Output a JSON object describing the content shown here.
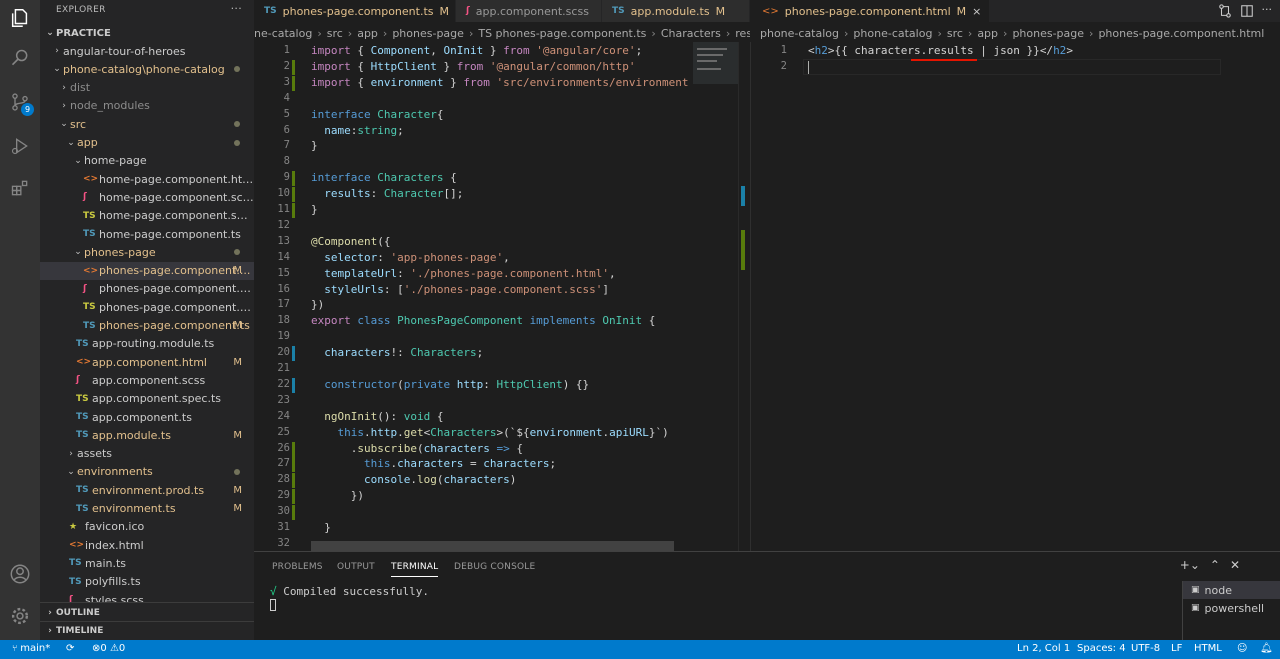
{
  "activity": {
    "source_control_badge": "9"
  },
  "sidebar": {
    "explorer_title": "EXPLORER",
    "section": "PRACTICE",
    "items": [
      {
        "label": "angular-tour-of-heroes",
        "indent": 1,
        "twisty": "›",
        "icon": "",
        "color": "#cccccc"
      },
      {
        "label": "phone-catalog\\phone-catalog",
        "indent": 1,
        "twisty": "⌄",
        "icon": "",
        "color": "#e2c08d",
        "dot": true
      },
      {
        "label": "dist",
        "indent": 2,
        "twisty": "›",
        "icon": "",
        "color": "#8c8c8c"
      },
      {
        "label": "node_modules",
        "indent": 2,
        "twisty": "›",
        "icon": "",
        "color": "#8c8c8c"
      },
      {
        "label": "src",
        "indent": 2,
        "twisty": "⌄",
        "icon": "",
        "color": "#e2c08d",
        "dot": true
      },
      {
        "label": "app",
        "indent": 3,
        "twisty": "⌄",
        "icon": "",
        "color": "#e2c08d",
        "dot": true
      },
      {
        "label": "home-page",
        "indent": 4,
        "twisty": "⌄",
        "icon": "",
        "color": "#cccccc"
      },
      {
        "label": "home-page.component.html",
        "indent": 5,
        "icon": "<>",
        "icolor": "#e37933",
        "color": "#cccccc"
      },
      {
        "label": "home-page.component.scss",
        "indent": 5,
        "icon": "ʃ",
        "icolor": "#f55385",
        "color": "#cccccc"
      },
      {
        "label": "home-page.component.spec.ts",
        "indent": 5,
        "icon": "TS",
        "icolor": "#cbcb41",
        "color": "#cccccc"
      },
      {
        "label": "home-page.component.ts",
        "indent": 5,
        "icon": "TS",
        "icolor": "#519aba",
        "color": "#cccccc"
      },
      {
        "label": "phones-page",
        "indent": 4,
        "twisty": "⌄",
        "icon": "",
        "color": "#e2c08d",
        "dot": true
      },
      {
        "label": "phones-page.component....",
        "indent": 5,
        "icon": "<>",
        "icolor": "#e37933",
        "color": "#e2c08d",
        "status": "M",
        "selected": true
      },
      {
        "label": "phones-page.component.scss",
        "indent": 5,
        "icon": "ʃ",
        "icolor": "#f55385",
        "color": "#cccccc"
      },
      {
        "label": "phones-page.component.spec.ts",
        "indent": 5,
        "icon": "TS",
        "icolor": "#cbcb41",
        "color": "#cccccc"
      },
      {
        "label": "phones-page.component.ts",
        "indent": 5,
        "icon": "TS",
        "icolor": "#519aba",
        "color": "#e2c08d",
        "status": "M"
      },
      {
        "label": "app-routing.module.ts",
        "indent": 4,
        "icon": "TS",
        "icolor": "#519aba",
        "color": "#cccccc"
      },
      {
        "label": "app.component.html",
        "indent": 4,
        "icon": "<>",
        "icolor": "#e37933",
        "color": "#e2c08d",
        "status": "M"
      },
      {
        "label": "app.component.scss",
        "indent": 4,
        "icon": "ʃ",
        "icolor": "#f55385",
        "color": "#cccccc"
      },
      {
        "label": "app.component.spec.ts",
        "indent": 4,
        "icon": "TS",
        "icolor": "#cbcb41",
        "color": "#cccccc"
      },
      {
        "label": "app.component.ts",
        "indent": 4,
        "icon": "TS",
        "icolor": "#519aba",
        "color": "#cccccc"
      },
      {
        "label": "app.module.ts",
        "indent": 4,
        "icon": "TS",
        "icolor": "#519aba",
        "color": "#e2c08d",
        "status": "M"
      },
      {
        "label": "assets",
        "indent": 3,
        "twisty": "›",
        "icon": "",
        "color": "#cccccc"
      },
      {
        "label": "environments",
        "indent": 3,
        "twisty": "⌄",
        "icon": "",
        "color": "#e2c08d",
        "dot": true
      },
      {
        "label": "environment.prod.ts",
        "indent": 4,
        "icon": "TS",
        "icolor": "#519aba",
        "color": "#e2c08d",
        "status": "M"
      },
      {
        "label": "environment.ts",
        "indent": 4,
        "icon": "TS",
        "icolor": "#519aba",
        "color": "#e2c08d",
        "status": "M"
      },
      {
        "label": "favicon.ico",
        "indent": 3,
        "icon": "★",
        "icolor": "#cbcb41",
        "color": "#cccccc"
      },
      {
        "label": "index.html",
        "indent": 3,
        "icon": "<>",
        "icolor": "#e37933",
        "color": "#cccccc"
      },
      {
        "label": "main.ts",
        "indent": 3,
        "icon": "TS",
        "icolor": "#519aba",
        "color": "#cccccc"
      },
      {
        "label": "polyfills.ts",
        "indent": 3,
        "icon": "TS",
        "icolor": "#519aba",
        "color": "#cccccc"
      },
      {
        "label": "styles.scss",
        "indent": 3,
        "icon": "ʃ",
        "icolor": "#f55385",
        "color": "#cccccc"
      }
    ],
    "outline": "OUTLINE",
    "timeline": "TIMELINE"
  },
  "editor_left": {
    "tabs": [
      {
        "icon": "TS",
        "label": "phones-page.component.ts",
        "status": "M",
        "close": "×",
        "active": true
      },
      {
        "icon": "ʃ",
        "label": "app.component.scss",
        "status": "",
        "close": "",
        "active": false
      },
      {
        "icon": "TS",
        "label": "app.module.ts",
        "status": "M",
        "close": "",
        "active": false
      }
    ],
    "breadcrumb": [
      "ne-catalog",
      "src",
      "app",
      "phones-page",
      "TS phones-page.component.ts",
      "Characters",
      "results"
    ],
    "lines": [
      [
        [
          "import ",
          "k"
        ],
        [
          "{ ",
          "p"
        ],
        [
          "Component",
          "v"
        ],
        [
          ", ",
          "p"
        ],
        [
          "OnInit",
          "v"
        ],
        [
          " } ",
          "p"
        ],
        [
          "from ",
          "k"
        ],
        [
          "'@angular/core'",
          "s"
        ],
        [
          ";",
          "p"
        ]
      ],
      [
        [
          "import ",
          "k"
        ],
        [
          "{ ",
          "p"
        ],
        [
          "HttpClient",
          "v"
        ],
        [
          " } ",
          "p"
        ],
        [
          "from ",
          "k"
        ],
        [
          "'@angular/common/http'",
          "s"
        ]
      ],
      [
        [
          "import ",
          "k"
        ],
        [
          "{ ",
          "p"
        ],
        [
          "environment",
          "v"
        ],
        [
          " } ",
          "p"
        ],
        [
          "from ",
          "k"
        ],
        [
          "'src/environments/environment'",
          "s"
        ],
        [
          ";",
          "p"
        ]
      ],
      [],
      [
        [
          "interface ",
          "b"
        ],
        [
          "Character",
          "t"
        ],
        [
          "{",
          "p"
        ]
      ],
      [
        [
          "  name",
          "v"
        ],
        [
          ":",
          "p"
        ],
        [
          "string",
          "t"
        ],
        [
          ";",
          "p"
        ]
      ],
      [
        [
          "}",
          "p"
        ]
      ],
      [],
      [
        [
          "interface ",
          "b"
        ],
        [
          "Characters",
          "t"
        ],
        [
          " {",
          "p"
        ]
      ],
      [
        [
          "  results",
          "v"
        ],
        [
          ": ",
          "p"
        ],
        [
          "Character",
          "t"
        ],
        [
          "[];",
          "p"
        ]
      ],
      [
        [
          "}",
          "p"
        ]
      ],
      [],
      [
        [
          "@Component",
          "f"
        ],
        [
          "({",
          "p"
        ]
      ],
      [
        [
          "  selector",
          "v"
        ],
        [
          ": ",
          "p"
        ],
        [
          "'app-phones-page'",
          "s"
        ],
        [
          ",",
          "p"
        ]
      ],
      [
        [
          "  templateUrl",
          "v"
        ],
        [
          ": ",
          "p"
        ],
        [
          "'./phones-page.component.html'",
          "s"
        ],
        [
          ",",
          "p"
        ]
      ],
      [
        [
          "  styleUrls",
          "v"
        ],
        [
          ": [",
          "p"
        ],
        [
          "'./phones-page.component.scss'",
          "s"
        ],
        [
          "]",
          "p"
        ]
      ],
      [
        [
          "})",
          "p"
        ]
      ],
      [
        [
          "export ",
          "k"
        ],
        [
          "class ",
          "b"
        ],
        [
          "PhonesPageComponent ",
          "t"
        ],
        [
          "implements ",
          "b"
        ],
        [
          "OnInit ",
          "t"
        ],
        [
          "{",
          "p"
        ]
      ],
      [],
      [
        [
          "  characters",
          "v"
        ],
        [
          "!: ",
          "p"
        ],
        [
          "Characters",
          "t"
        ],
        [
          ";",
          "p"
        ]
      ],
      [],
      [
        [
          "  constructor",
          "b"
        ],
        [
          "(",
          "p"
        ],
        [
          "private ",
          "b"
        ],
        [
          "http",
          "v"
        ],
        [
          ": ",
          "p"
        ],
        [
          "HttpClient",
          "t"
        ],
        [
          ") {}",
          "p"
        ]
      ],
      [],
      [
        [
          "  ngOnInit",
          "f"
        ],
        [
          "(): ",
          "p"
        ],
        [
          "void ",
          "t"
        ],
        [
          "{",
          "p"
        ]
      ],
      [
        [
          "    this",
          "b"
        ],
        [
          ".",
          "p"
        ],
        [
          "http",
          "v"
        ],
        [
          ".",
          "p"
        ],
        [
          "get",
          "f"
        ],
        [
          "<",
          "p"
        ],
        [
          "Characters",
          "t"
        ],
        [
          ">(`${",
          "p"
        ],
        [
          "environment",
          "v"
        ],
        [
          ".",
          "p"
        ],
        [
          "apiURL",
          "v"
        ],
        [
          "}`)",
          "p"
        ]
      ],
      [
        [
          "      .",
          "p"
        ],
        [
          "subscribe",
          "f"
        ],
        [
          "(",
          "p"
        ],
        [
          "characters ",
          "v"
        ],
        [
          "=> ",
          "b"
        ],
        [
          "{",
          "p"
        ]
      ],
      [
        [
          "        this",
          "b"
        ],
        [
          ".",
          "p"
        ],
        [
          "characters ",
          "v"
        ],
        [
          "= ",
          "p"
        ],
        [
          "characters",
          "v"
        ],
        [
          ";",
          "p"
        ]
      ],
      [
        [
          "        console",
          "v"
        ],
        [
          ".",
          "p"
        ],
        [
          "log",
          "f"
        ],
        [
          "(",
          "p"
        ],
        [
          "characters",
          "v"
        ],
        [
          ")",
          "p"
        ]
      ],
      [
        [
          "      })",
          "p"
        ]
      ],
      [],
      [
        [
          "  }",
          "p"
        ]
      ],
      []
    ]
  },
  "editor_right": {
    "tab": {
      "icon": "<>",
      "label": "phones-page.component.html",
      "status": "M",
      "close": "×"
    },
    "breadcrumb": [
      "phone-catalog",
      "phone-catalog",
      "src",
      "app",
      "phones-page",
      "phones-page.component.html"
    ],
    "lines": [
      [
        [
          "<",
          "p"
        ],
        [
          "h2",
          "b"
        ],
        [
          ">",
          "p"
        ],
        [
          "{{ characters.results | json }}",
          "p"
        ],
        [
          "</",
          "p"
        ],
        [
          "h2",
          "b"
        ],
        [
          ">",
          "p"
        ]
      ],
      []
    ]
  },
  "panel": {
    "tabs": [
      "PROBLEMS",
      "OUTPUT",
      "TERMINAL",
      "DEBUG CONSOLE"
    ],
    "active_tab": "TERMINAL",
    "terminal_check": "√",
    "terminal_text": "Compiled successfully.",
    "terminals": [
      "node",
      "powershell"
    ]
  },
  "status": {
    "branch": "main*",
    "errors": "0",
    "warnings": "0",
    "position": "Ln 2, Col 1",
    "spaces": "Spaces: 4",
    "encoding": "UTF-8",
    "eol": "LF",
    "language": "HTML"
  }
}
